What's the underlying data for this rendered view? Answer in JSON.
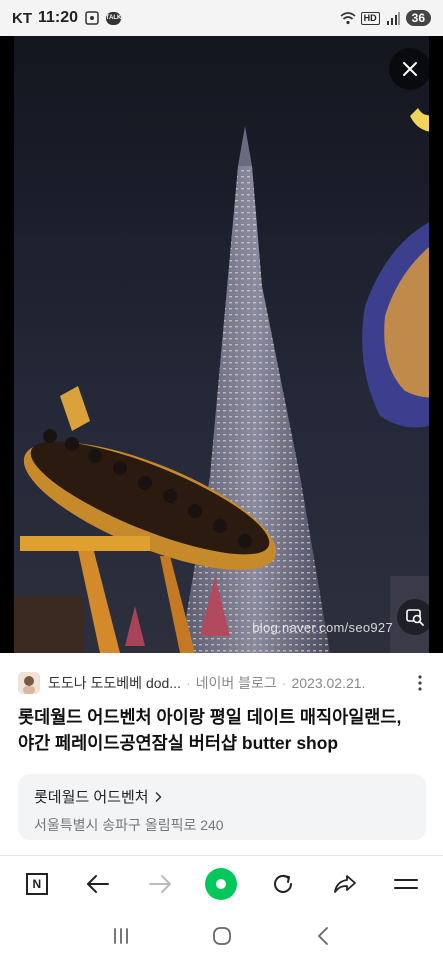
{
  "status_bar": {
    "carrier": "KT",
    "time": "11:20",
    "talk_label": "TALK",
    "hd_label": "HD",
    "battery": "36"
  },
  "photo": {
    "watermark": "blog.naver.com/seo927",
    "close_icon": "close-icon",
    "lens_icon": "image-search-icon"
  },
  "source": {
    "blog_name": "도도나 도도베베 dod...",
    "platform": "네이버 블로그",
    "date": "2023.02.21.",
    "separator": "·"
  },
  "title": "롯데월드 어드벤처 아이랑 평일 데이트 매직아일랜드, 야간 페레이드공연잠실 버터샵 butter shop",
  "place": {
    "name": "롯데월드 어드벤처",
    "address": "서울특별시 송파구 올림픽로 240"
  },
  "toolbar": {
    "n_label": "N",
    "icons": [
      "naver-n-icon",
      "back-arrow-icon",
      "forward-arrow-icon",
      "green-home-icon",
      "refresh-icon",
      "share-icon",
      "menu-icon"
    ]
  },
  "colors": {
    "naver_green": "#03c75a",
    "sky": "#1a1d2b"
  }
}
